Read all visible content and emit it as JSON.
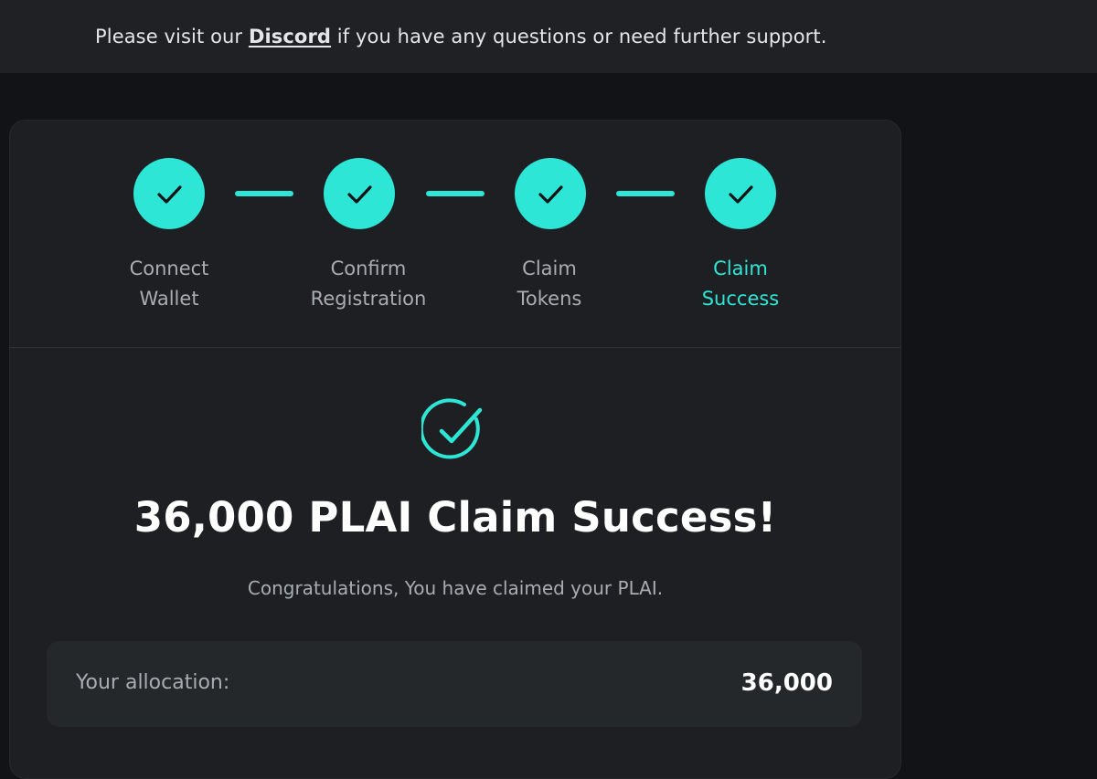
{
  "banner": {
    "prefix": "Please visit our ",
    "link_label": "Discord",
    "suffix": " if you have any questions or need further support."
  },
  "steps": [
    {
      "line1": "Connect",
      "line2": "Wallet",
      "status": "complete"
    },
    {
      "line1": "Confirm",
      "line2": "Registration",
      "status": "complete"
    },
    {
      "line1": "Claim",
      "line2": "Tokens",
      "status": "complete"
    },
    {
      "line1": "Claim",
      "line2": "Success",
      "status": "active"
    }
  ],
  "result": {
    "icon": "check-circle-icon",
    "title": "36,000 PLAI Claim Success!",
    "message": "Congratulations, You have claimed your PLAI."
  },
  "allocation": {
    "label": "Your allocation:",
    "value": "36,000"
  },
  "colors": {
    "accent": "#2ee6d6",
    "background": "#121316",
    "card": "#1d1f22",
    "banner": "#1f2124"
  }
}
